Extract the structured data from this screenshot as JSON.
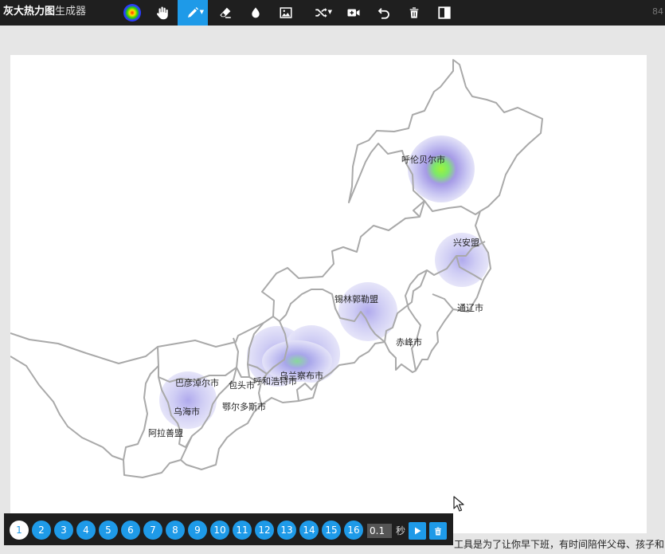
{
  "app": {
    "title_bold": "灰大热力图",
    "title_rest": "生成器",
    "right_fragment": "84"
  },
  "toolbar": {
    "tools": [
      {
        "name": "heatmap-gradient-icon"
      },
      {
        "name": "hand-pan-icon"
      },
      {
        "name": "brush-icon",
        "active": true
      },
      {
        "name": "eraser-icon"
      },
      {
        "name": "opacity-drop-icon"
      },
      {
        "name": "image-icon"
      },
      {
        "name": "shuffle-icon"
      },
      {
        "name": "record-video-icon"
      },
      {
        "name": "undo-icon"
      },
      {
        "name": "trash-icon"
      },
      {
        "name": "toggle-panel-icon"
      }
    ],
    "accent": "#1e9ae8"
  },
  "map": {
    "labels": {
      "hulunbuir": "呼伦贝尔市",
      "xinganmeng": "兴安盟",
      "tongliao": "通辽市",
      "xilingol": "锡林郭勒盟",
      "chifeng": "赤峰市",
      "ulanqab": "乌兰察布市",
      "hohhot": "呼和浩特市",
      "baotou": "包头市",
      "bayannur": "巴彦淖尔市",
      "wuhai": "乌海市",
      "ordos": "鄂尔多斯市",
      "alxa": "阿拉善盟"
    }
  },
  "frames": {
    "items": [
      "1",
      "2",
      "3",
      "4",
      "5",
      "6",
      "7",
      "8",
      "9",
      "10",
      "11",
      "12",
      "13",
      "14",
      "15",
      "16"
    ],
    "current": "1",
    "interval": "0.1",
    "interval_unit": "秒"
  },
  "footer": {
    "text": "工具是为了让你早下班，有时间陪伴父母、孩子和家"
  }
}
